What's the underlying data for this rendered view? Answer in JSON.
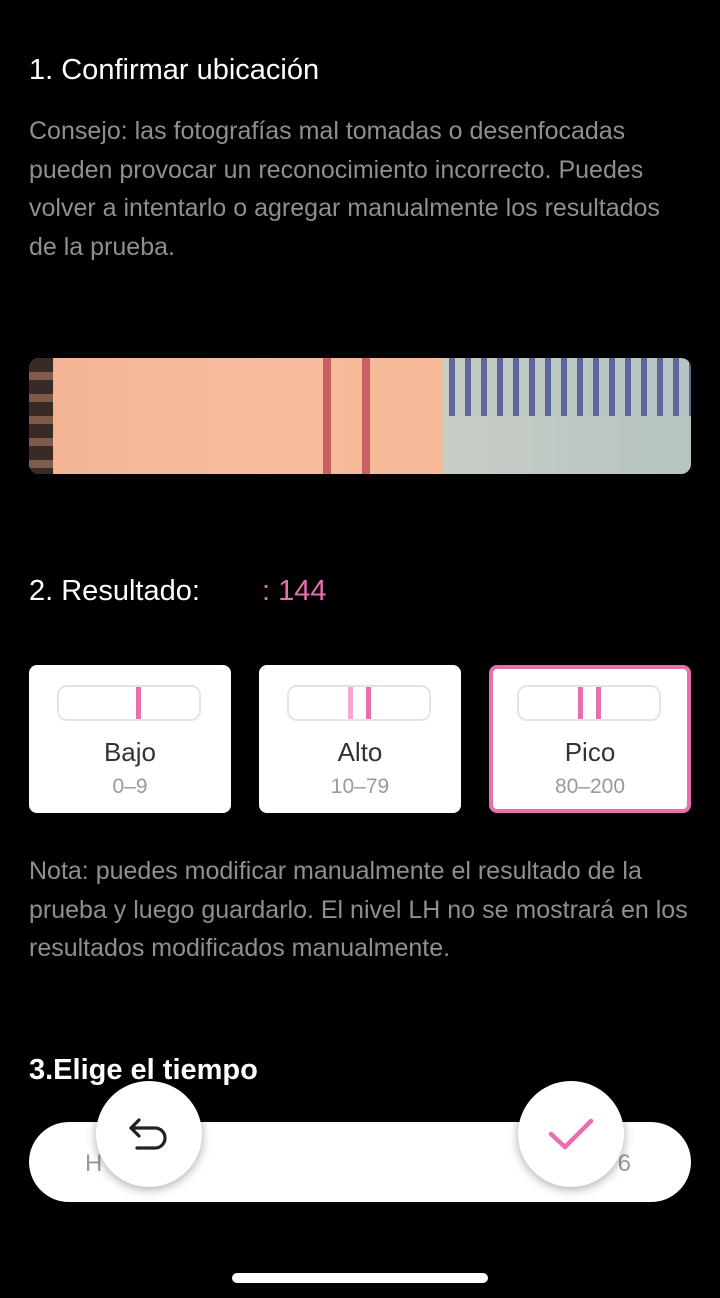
{
  "step1": {
    "title": "1. Confirmar ubicación",
    "tip": "Consejo: las fotografías mal tomadas o desenfocadas pueden provocar un reconocimiento incorrecto. Puedes volver a intentarlo o agregar manualmente los resultados de la prueba."
  },
  "step2": {
    "title": "2. Resultado:",
    "value": ": 144",
    "options": [
      {
        "name": "Bajo",
        "range": "0–9"
      },
      {
        "name": "Alto",
        "range": "10–79"
      },
      {
        "name": "Pico",
        "range": "80–200",
        "selected": true
      }
    ],
    "note": "Nota: puedes modificar manualmente el resultado de la prueba y luego guardarlo. El nivel LH no se mostrará en los resultados modificados manualmente."
  },
  "step3": {
    "title": "3.Elige el tiempo",
    "time_left": "H",
    "time_right": "6"
  },
  "colors": {
    "accent": "#e96eb0",
    "background": "#000000",
    "muted_text": "#8f8f8f"
  },
  "icons": {
    "undo": "undo-icon",
    "confirm": "check-icon"
  }
}
